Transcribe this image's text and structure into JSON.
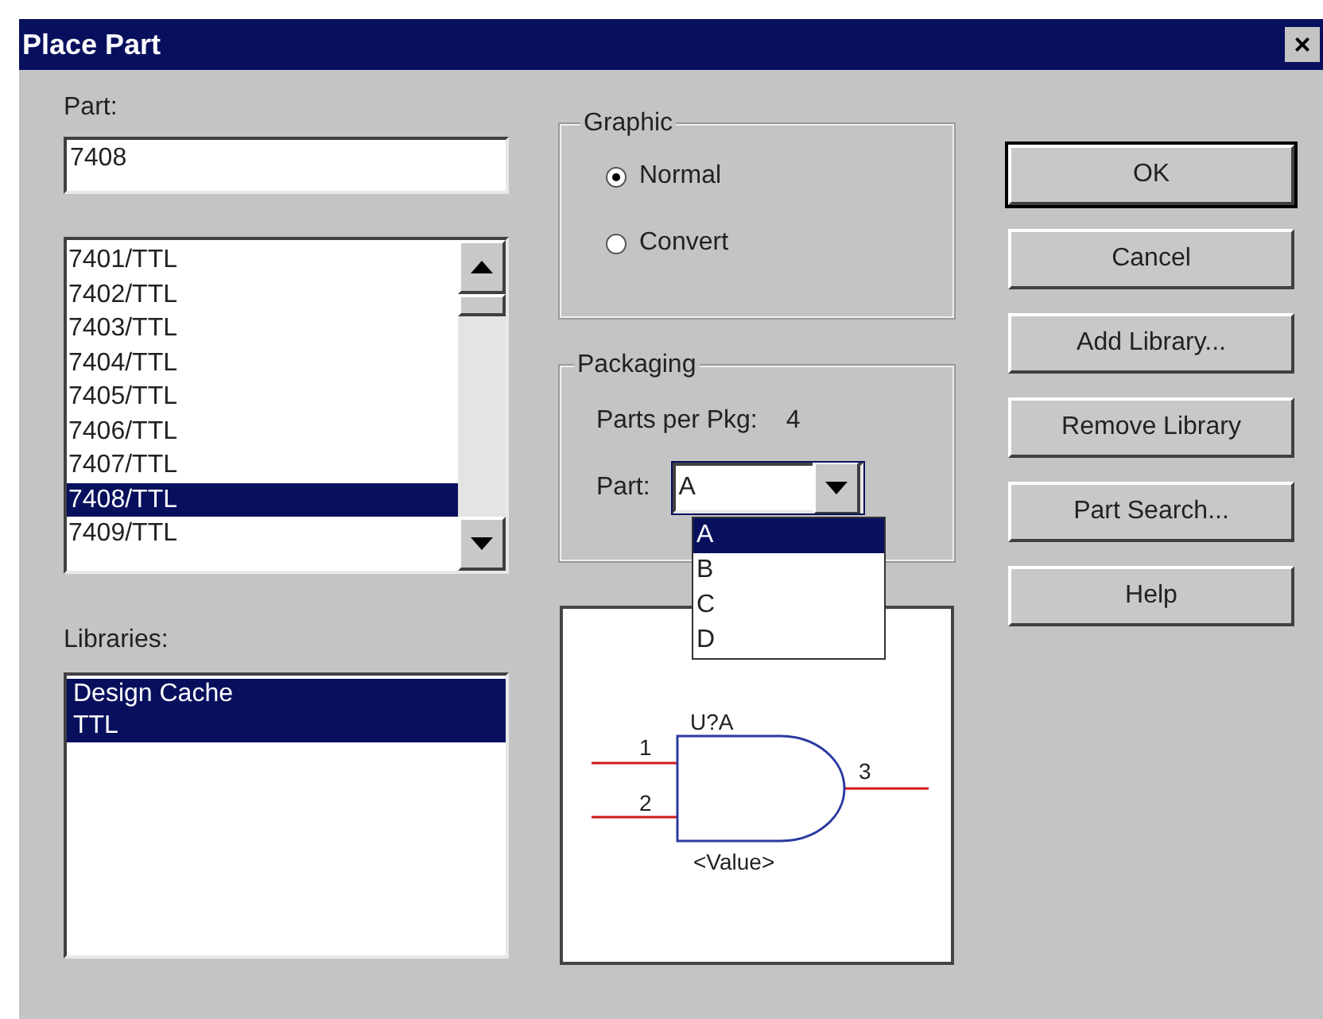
{
  "window": {
    "title": "Place Part",
    "close": "×"
  },
  "part_field": {
    "label": "Part:",
    "value": "7408"
  },
  "part_list": {
    "items": [
      {
        "label": "7401/TTL",
        "selected": false
      },
      {
        "label": "7402/TTL",
        "selected": false
      },
      {
        "label": "7403/TTL",
        "selected": false
      },
      {
        "label": "7404/TTL",
        "selected": false
      },
      {
        "label": "7405/TTL",
        "selected": false
      },
      {
        "label": "7406/TTL",
        "selected": false
      },
      {
        "label": "7407/TTL",
        "selected": false
      },
      {
        "label": "7408/TTL",
        "selected": true
      },
      {
        "label": "7409/TTL",
        "selected": false
      }
    ]
  },
  "libraries": {
    "label": "Libraries:",
    "items": [
      {
        "label": "Design Cache",
        "selected": true
      },
      {
        "label": "TTL",
        "selected": true
      }
    ]
  },
  "graphic": {
    "title": "Graphic",
    "options": [
      {
        "label": "Normal",
        "selected": true
      },
      {
        "label": "Convert",
        "selected": false
      }
    ]
  },
  "packaging": {
    "title": "Packaging",
    "parts_per_pkg_label": "Parts per Pkg:",
    "parts_per_pkg": "4",
    "part_label": "Part:",
    "part_value": "A",
    "expanded": true,
    "options": [
      {
        "label": "A",
        "selected": true
      },
      {
        "label": "B",
        "selected": false
      },
      {
        "label": "C",
        "selected": false
      },
      {
        "label": "D",
        "selected": false
      }
    ]
  },
  "preview": {
    "reference": "U?A",
    "value": "<Value>",
    "pins": [
      "1",
      "2",
      "3"
    ]
  },
  "buttons": [
    {
      "label": "OK",
      "default": true
    },
    {
      "label": "Cancel",
      "default": false
    },
    {
      "label": "Add Library...",
      "default": false
    },
    {
      "label": "Remove Library",
      "default": false
    },
    {
      "label": "Part Search...",
      "default": false
    },
    {
      "label": "Help",
      "default": false
    }
  ]
}
